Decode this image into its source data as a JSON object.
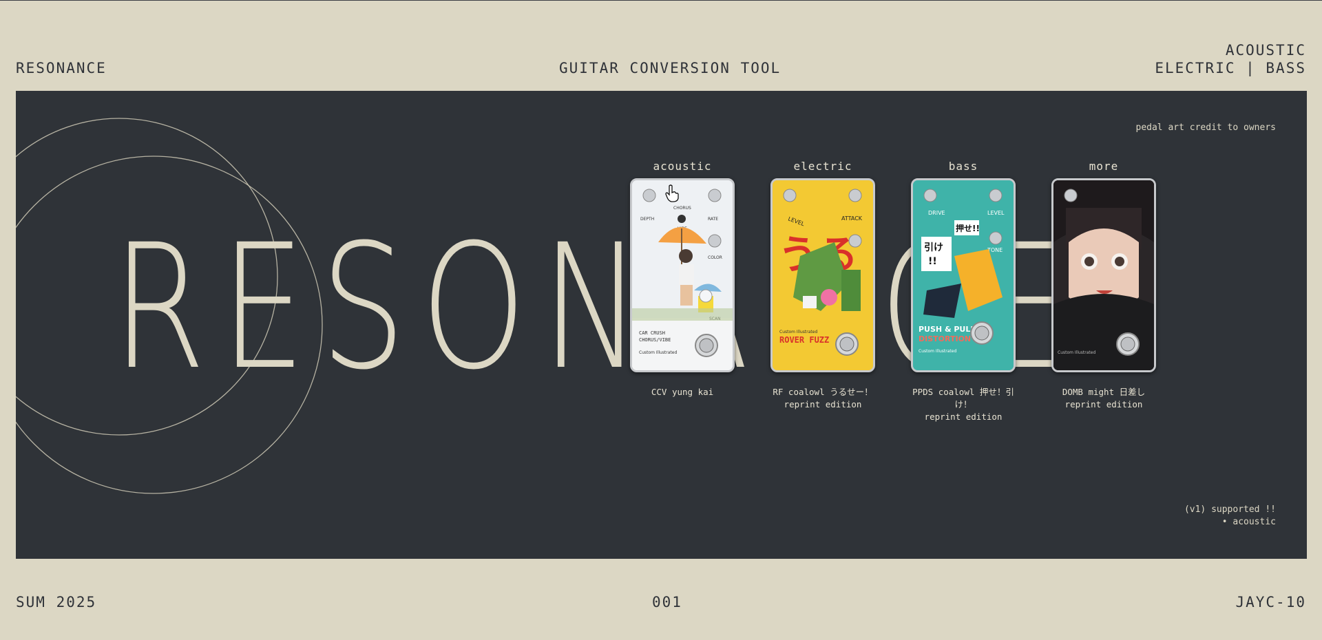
{
  "header": {
    "brand": "RESONANCE",
    "title": "GUITAR CONVERSION TOOL",
    "modes_line1": "ACOUSTIC",
    "modes_line2": "ELECTRIC | BASS"
  },
  "hero": {
    "big_word": "RESONANCE",
    "credit": "pedal art credit to owners"
  },
  "pedals": [
    {
      "category": "acoustic",
      "name_line1": "CCV yung kai",
      "name_line2": "",
      "art_text": [
        "DEPTH",
        "CHORUS",
        "VIBE",
        "RATE",
        "COLOR",
        "SCAN",
        "CAR CRUSH",
        "CHORUS/VIBE",
        "Custom Illustrated"
      ],
      "color": "#e9eef2"
    },
    {
      "category": "electric",
      "name_line1": "RF coalowl うるせー！",
      "name_line2": "reprint edition",
      "art_text": [
        "LEVEL",
        "ATTACK",
        "うる",
        "ROVER FUZZ"
      ],
      "color": "#f3c933"
    },
    {
      "category": "bass",
      "name_line1": "PPDS coalowl 押せ！引け！",
      "name_line2": "reprint edition",
      "art_text": [
        "DRIVE",
        "LEVEL",
        "TONE",
        "押せ!!",
        "引け!!",
        "PUSH & PULL",
        "DISTORTION",
        "Custom Illustrated"
      ],
      "color": "#3fb3a9"
    },
    {
      "category": "more",
      "name_line1": "DOMB might 日差し",
      "name_line2": "reprint edition",
      "art_text": [
        "Custom Illustrated"
      ],
      "color": "#2a2628"
    }
  ],
  "support": {
    "heading": "(v1) supported !!",
    "items": [
      "acoustic"
    ]
  },
  "footer": {
    "season": "SUM 2025",
    "issue": "001",
    "author": "JAYC-10"
  }
}
